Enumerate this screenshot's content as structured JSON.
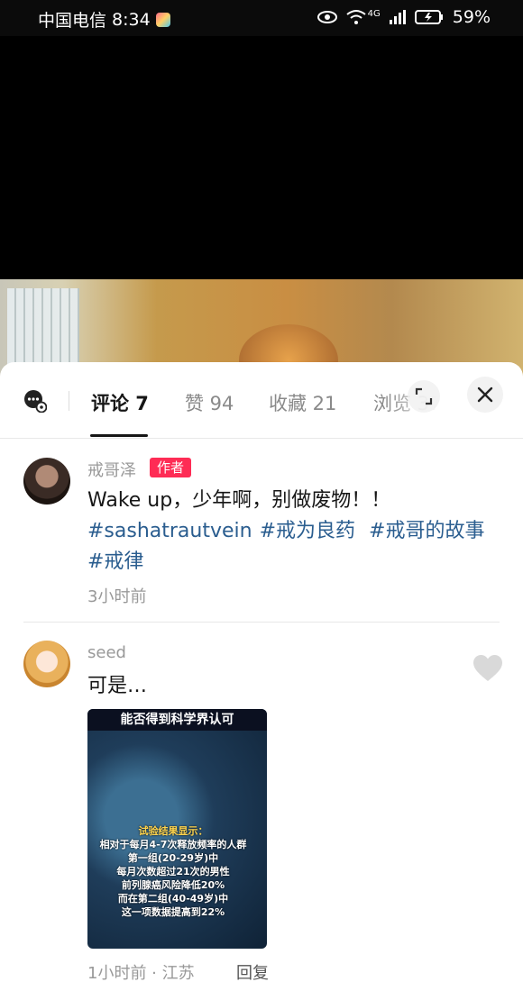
{
  "status_bar": {
    "carrier": "中国电信",
    "time": "8:34",
    "network": "4G",
    "battery": "59%"
  },
  "tabs": [
    {
      "label": "评论 7",
      "active": true
    },
    {
      "label": "赞 94",
      "active": false
    },
    {
      "label": "收藏 21",
      "active": false
    },
    {
      "label": "浏览 376",
      "active": false
    }
  ],
  "comments": [
    {
      "username": "戒哥泽",
      "badge": "作者",
      "text": "Wake up，少年啊，别做废物！！",
      "tags": [
        "#sashatrautvein",
        "#戒为良药",
        "#戒哥的故事",
        "#戒律"
      ],
      "time": "3小时前"
    },
    {
      "username": "seed",
      "text": "可是…",
      "image": {
        "title": "能否得到科学界认可",
        "lines": [
          "试验结果显示：",
          "相对于每月4-7次释放频率的人群",
          "第一组(20-29岁)中",
          "每月次数超过21次的男性",
          "前列腺癌风险降低20%",
          "而在第二组(40-49岁)中",
          "这一项数据提高到22%"
        ]
      },
      "time": "1小时前",
      "location": "江苏",
      "reply_label": "回复"
    }
  ],
  "colors": {
    "accent": "#fe2c55",
    "hashtag": "#2a5d8f"
  }
}
